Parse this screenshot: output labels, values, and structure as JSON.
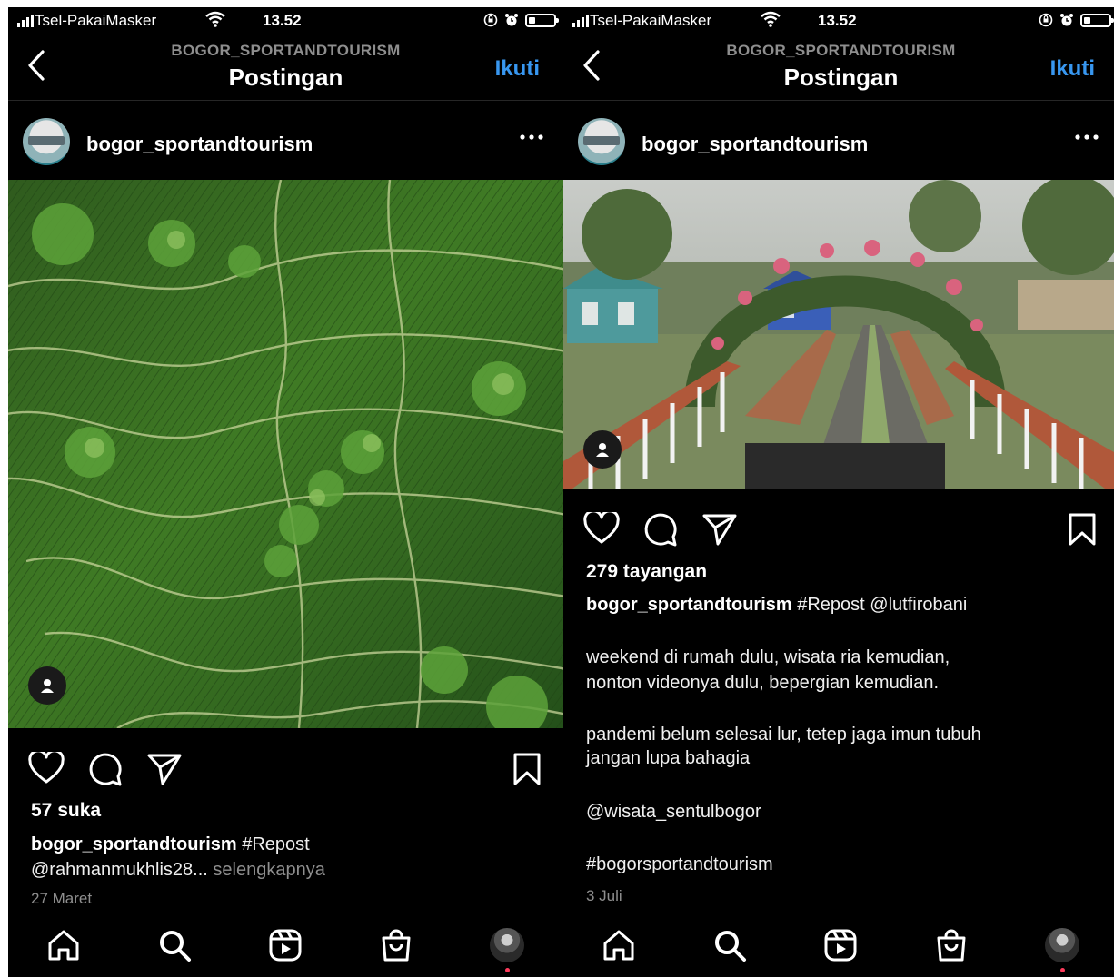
{
  "status_bar": {
    "carrier": "Tsel-PakaiMasker",
    "time": "13.52"
  },
  "nav": {
    "subtitle": "BOGOR_SPORTANDTOURISM",
    "title": "Postingan",
    "follow_label": "Ikuti"
  },
  "icons": {
    "back": "back-chevron-icon",
    "more": "more-options-icon",
    "like": "heart-icon",
    "comment": "comment-icon",
    "share": "send-icon",
    "save": "bookmark-icon",
    "home": "home-icon",
    "search": "search-icon",
    "reels": "reels-icon",
    "shop": "shop-icon",
    "profile": "profile-avatar",
    "tagged": "tagged-person-icon"
  },
  "colors": {
    "background": "#000000",
    "accent_link": "#3897f0",
    "muted": "#8e8e8e",
    "notification": "#ff3b5c"
  },
  "posts": [
    {
      "username": "bogor_sportandtourism",
      "media_type": "photo",
      "stats": "57 suka",
      "caption_user": "bogor_sportandtourism",
      "caption_text_1": "#Repost",
      "caption_text_2": "@rahmanmukhlis28...",
      "more_label": "selengkapnya",
      "date": "27 Maret"
    },
    {
      "username": "bogor_sportandtourism",
      "media_type": "video",
      "stats": "279 tayangan",
      "caption_user": "bogor_sportandtourism",
      "caption_text_1": "#Repost @lutfirobani",
      "paragraphs": [
        "weekend di rumah dulu, wisata ria kemudian,",
        "nonton videonya dulu, bepergian kemudian.",
        "pandemi belum selesai lur, tetep jaga imun tubuh",
        "jangan lupa bahagia",
        "@wisata_sentulbogor",
        "#bogorsportandtourism"
      ],
      "date": "3 Juli"
    }
  ]
}
